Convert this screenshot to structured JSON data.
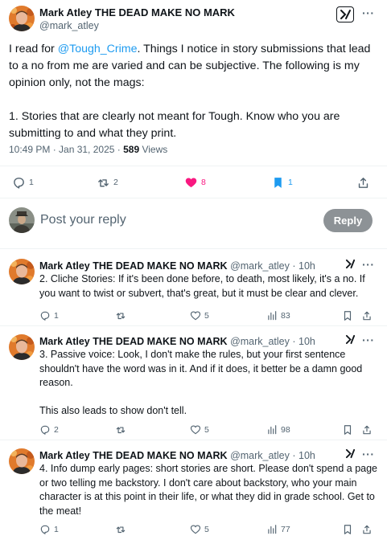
{
  "main_post": {
    "author_name": "Mark Atley THE DEAD MAKE NO MARK",
    "author_handle": "@mark_atley",
    "text_before_mention": "I read for ",
    "mention": "@Tough_Crime",
    "text_after_mention": ". Things I notice in story submissions that lead to a no from me are varied and can be subjective. The following is my opinion only, not the mags:\n\n1. Stories that are clearly not meant for Tough. Know who you are submitting to and what they print.",
    "timestamp": "10:49 PM · Jan 31, 2025 · ",
    "views_count": "589",
    "views_label": " Views",
    "replies": "1",
    "reposts": "2",
    "likes": "8",
    "bookmarks": "1"
  },
  "reply_box": {
    "placeholder": "Post your reply",
    "button_label": "Reply"
  },
  "thread": [
    {
      "author_name": "Mark Atley THE DEAD MAKE NO MARK",
      "handle_time": " @mark_atley · 10h",
      "text": "2. Cliche Stories: If it's been done before, to death, most likely, it's a no. If you want to twist or subvert, that's great, but it must be clear and clever.",
      "replies": "1",
      "reposts": "",
      "likes": "5",
      "views": "83"
    },
    {
      "author_name": "Mark Atley THE DEAD MAKE NO MARK",
      "handle_time": " @mark_atley · 10h",
      "text": "3. Passive voice: Look, I don't make the rules, but your first sentence shouldn't have the word was in it. And if it does, it better be a damn good reason.\n\nThis also leads to show don't tell.",
      "replies": "2",
      "reposts": "",
      "likes": "5",
      "views": "98"
    },
    {
      "author_name": "Mark Atley THE DEAD MAKE NO MARK",
      "handle_time": " @mark_atley · 10h",
      "text": "4. Info dump early pages: short stories are short. Please don't spend a page or two telling me backstory. I don't care about backstory, who your main character is at this point in their life, or what they did in grade school. Get to the meat!",
      "replies": "1",
      "reposts": "",
      "likes": "5",
      "views": "77"
    }
  ],
  "colors": {
    "text": "#0f1419",
    "secondary": "#536471",
    "link": "#1d9bf0",
    "like_active": "#f91880",
    "bookmark_active": "#1d9bf0",
    "reply_button_bg": "#8d9296",
    "divider": "#eff3f4"
  },
  "icons": [
    "grok-icon",
    "more-icon",
    "reply-icon",
    "repost-icon",
    "like-icon",
    "bookmark-icon",
    "share-icon",
    "views-icon"
  ]
}
